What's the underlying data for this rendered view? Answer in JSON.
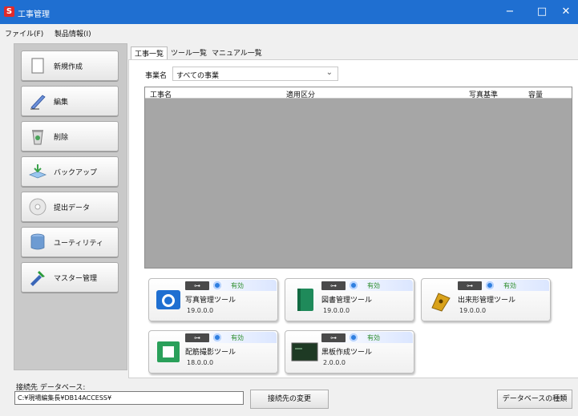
{
  "window": {
    "title": "工事管理",
    "app_icon_glyph": "S",
    "controls": {
      "minimize": "−",
      "maximize": "□",
      "close": "✕"
    },
    "accent": "#1f6fd1"
  },
  "menu": [
    {
      "label": "ファイル(F)"
    },
    {
      "label": "製品情報(I)"
    }
  ],
  "sidebar": {
    "items": [
      {
        "label": "新規作成",
        "icon": "document-icon"
      },
      {
        "label": "編集",
        "icon": "pen-icon"
      },
      {
        "label": "削除",
        "icon": "trash-icon"
      },
      {
        "label": "バックアップ",
        "icon": "backup-icon"
      },
      {
        "label": "提出データ",
        "icon": "disc-icon"
      },
      {
        "label": "ユーティリティ",
        "icon": "cylinder-icon"
      },
      {
        "label": "マスター管理",
        "icon": "tools-icon"
      }
    ]
  },
  "tabs": [
    {
      "label": "工事一覧",
      "active": true
    },
    {
      "label": "ツール一覧",
      "active": false
    },
    {
      "label": "マニュアル一覧",
      "active": false
    }
  ],
  "filter": {
    "label": "事業名",
    "selected": "すべての事業",
    "chevron": "⌄"
  },
  "grid": {
    "columns": [
      "工事名",
      "適用区分",
      "写真基準",
      "容量"
    ],
    "rows": []
  },
  "tools": [
    {
      "name": "写真管理ツール",
      "version": "19.0.0.0",
      "status": "有効",
      "icon": "camera-icon",
      "usb": "⊶"
    },
    {
      "name": "図書管理ツール",
      "version": "19.0.0.0",
      "status": "有効",
      "icon": "book-icon",
      "usb": "⊶"
    },
    {
      "name": "出来形管理ツール",
      "version": "19.0.0.0",
      "status": "有効",
      "icon": "pen-nib-icon",
      "usb": "⊶"
    },
    {
      "name": "配筋撮影ツール",
      "version": "18.0.0.0",
      "status": "有効",
      "icon": "rebar-icon",
      "usb": "⊶"
    },
    {
      "name": "黒板作成ツール",
      "version": "2.0.0.0",
      "status": "有効",
      "icon": "blackboard-icon",
      "usb": "⊶"
    }
  ],
  "database": {
    "label": "接続先 データベース:",
    "path": "C:¥現場編集長¥DB14ACCESS¥",
    "change_button": "接続先の変更",
    "type_button": "データベースの種類"
  },
  "colors": {
    "status_ok": "#2a8c2a",
    "grid_bg": "#a6a6a6",
    "title_bar": "#1f6fd1"
  }
}
